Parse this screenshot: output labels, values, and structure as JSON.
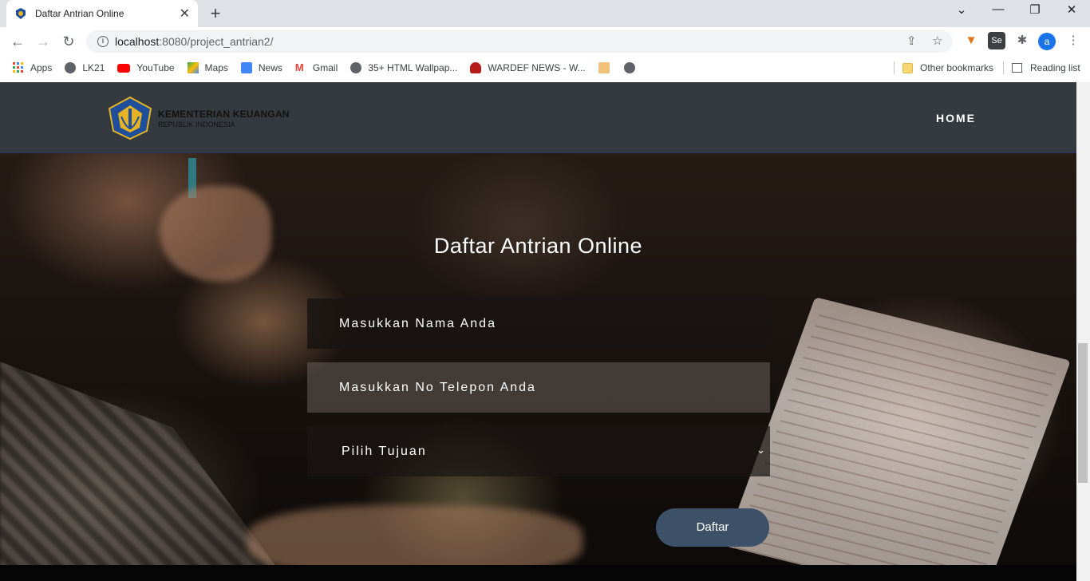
{
  "browser": {
    "tab_title": "Daftar Antrian Online",
    "url_host": "localhost",
    "url_rest": ":8080/project_antrian2/",
    "bookmarks": [
      "Apps",
      "LK21",
      "YouTube",
      "Maps",
      "News",
      "Gmail",
      "35+ HTML Wallpap...",
      "WARDEF NEWS - W..."
    ],
    "other_bookmarks": "Other bookmarks",
    "reading_list": "Reading list",
    "profile_initial": "a"
  },
  "header": {
    "logo_line1": "KEMENTERIAN KEUANGAN",
    "logo_line2": "REPUBLIK INDONESIA",
    "nav_home": "HOME"
  },
  "form": {
    "title": "Daftar Antrian Online",
    "name_placeholder": "Masukkan Nama Anda",
    "phone_placeholder": "Masukkan No Telepon Anda",
    "destination_selected": "Pilih Tujuan",
    "submit_label": "Daftar"
  },
  "colors": {
    "header_bg": "#343a40",
    "button_bg": "#3d5268"
  }
}
